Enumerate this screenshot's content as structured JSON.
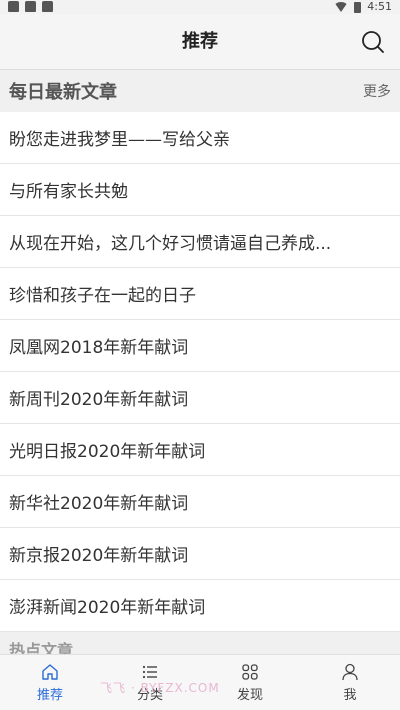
{
  "status_bar": {
    "time": "4:51"
  },
  "header": {
    "title": "推荐"
  },
  "section_daily": {
    "title": "每日最新文章",
    "more_label": "更多",
    "items": [
      "盼您走进我梦里——写给父亲",
      "与所有家长共勉",
      "从现在开始，这几个好习惯请逼自己养成...",
      "珍惜和孩子在一起的日子",
      "凤凰网2018年新年献词",
      "新周刊2020年新年献词",
      "光明日报2020年新年献词",
      "新华社2020年新年献词",
      "新京报2020年新年献词",
      "澎湃新闻2020年新年献词"
    ]
  },
  "section_hot": {
    "title": "热点文章"
  },
  "tab_bar": {
    "tabs": [
      {
        "label": "推荐",
        "icon": "home-icon"
      },
      {
        "label": "分类",
        "icon": "list-icon"
      },
      {
        "label": "发现",
        "icon": "grid-icon"
      },
      {
        "label": "我",
        "icon": "user-icon"
      }
    ]
  },
  "watermark": "飞飞 · BYFZX.COM",
  "colors": {
    "accent": "#2b6cd8"
  }
}
